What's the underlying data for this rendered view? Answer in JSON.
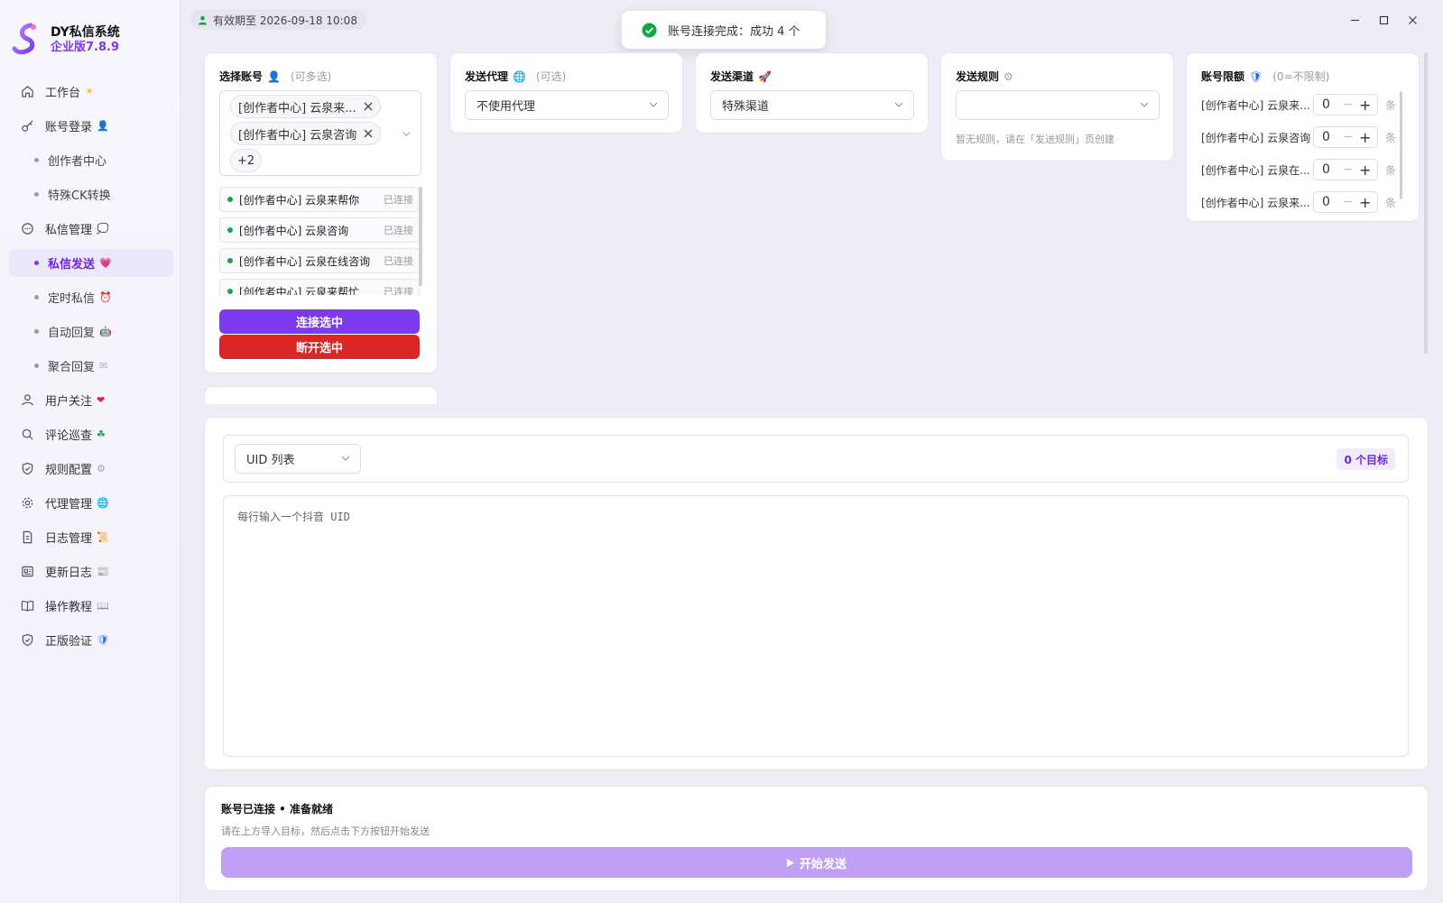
{
  "brand": {
    "name": "DY私信系统",
    "version": "企业版7.8.9"
  },
  "sidebar": {
    "items": [
      {
        "label": "工作台",
        "emoji": "☀",
        "icon": "home-icon"
      },
      {
        "label": "账号登录",
        "emoji": "👤",
        "icon": "key-icon"
      },
      {
        "label": "创作者中心",
        "sub": true
      },
      {
        "label": "特殊CK转换",
        "sub": true
      },
      {
        "label": "私信管理",
        "emoji": "💭",
        "icon": "chat-icon"
      },
      {
        "label": "私信发送",
        "emoji": "💗",
        "sub": true,
        "active": true
      },
      {
        "label": "定时私信",
        "emoji": "⏰",
        "sub": true
      },
      {
        "label": "自动回复",
        "emoji": "🤖",
        "sub": true
      },
      {
        "label": "聚合回复",
        "emoji": "✉",
        "sub": true
      },
      {
        "label": "用户关注",
        "emoji": "❤",
        "icon": "user-icon"
      },
      {
        "label": "评论巡查",
        "emoji": "☘",
        "icon": "search-icon"
      },
      {
        "label": "规则配置",
        "emoji": "⚙",
        "icon": "shield-icon"
      },
      {
        "label": "代理管理",
        "emoji": "🌐",
        "icon": "gear-icon"
      },
      {
        "label": "日志管理",
        "emoji": "📜",
        "icon": "document-icon"
      },
      {
        "label": "更新日志",
        "emoji": "📰",
        "icon": "news-icon"
      },
      {
        "label": "操作教程",
        "emoji": "📖",
        "icon": "book-icon"
      },
      {
        "label": "正版验证",
        "emoji": "🛡",
        "icon": "shield-check-icon"
      }
    ]
  },
  "topbar": {
    "validity": "有效期至 2026-09-18 10:08"
  },
  "toast": {
    "message": "账号连接完成：成功 4 个"
  },
  "accounts_card": {
    "title": "选择账号",
    "title_emoji": "👤",
    "hint": "(可多选)",
    "tags": [
      "[创作者中心] 云泉来...",
      "[创作者中心] 云泉咨询"
    ],
    "more": "+2",
    "list": [
      {
        "name": "[创作者中心] 云泉来帮你",
        "status": "已连接"
      },
      {
        "name": "[创作者中心] 云泉咨询",
        "status": "已连接"
      },
      {
        "name": "[创作者中心] 云泉在线咨询",
        "status": "已连接"
      },
      {
        "name": "[创作者中心] 云泉来帮忙",
        "status": "已连接"
      }
    ],
    "connect_label": "连接选中",
    "disconnect_label": "断开选中"
  },
  "proxy_card": {
    "title": "发送代理",
    "title_emoji": "🌐",
    "hint": "(可选)",
    "value": "不使用代理"
  },
  "channel_card": {
    "title": "发送渠道",
    "title_emoji": "🚀",
    "value": "特殊渠道"
  },
  "rule_card": {
    "title": "发送规则",
    "title_emoji": "⚙",
    "value": "",
    "note": "暂无规则，请在「发送规则」页创建"
  },
  "limit_card": {
    "title": "账号限额",
    "title_emoji": "🛡",
    "hint": "(0=不限制)",
    "unit": "条",
    "rows": [
      {
        "label": "[创作者中心] 云泉来...",
        "value": "0"
      },
      {
        "label": "[创作者中心] 云泉咨询",
        "value": "0"
      },
      {
        "label": "[创作者中心] 云泉在...",
        "value": "0"
      },
      {
        "label": "[创作者中心] 云泉来...",
        "value": "0"
      }
    ]
  },
  "uid_panel": {
    "mode": "UID 列表",
    "target_count": "0 个目标",
    "placeholder": "每行输入一个抖音 UID"
  },
  "send_panel": {
    "title": "账号已连接 • 准备就绪",
    "subtitle": "请在上方导入目标，然后点击下方按钮开始发送",
    "button": "开始发送"
  },
  "colors": {
    "accent": "#7c3aed",
    "danger": "#dc2626",
    "success": "#16a34a",
    "send_disabled": "#bfa0f5"
  }
}
